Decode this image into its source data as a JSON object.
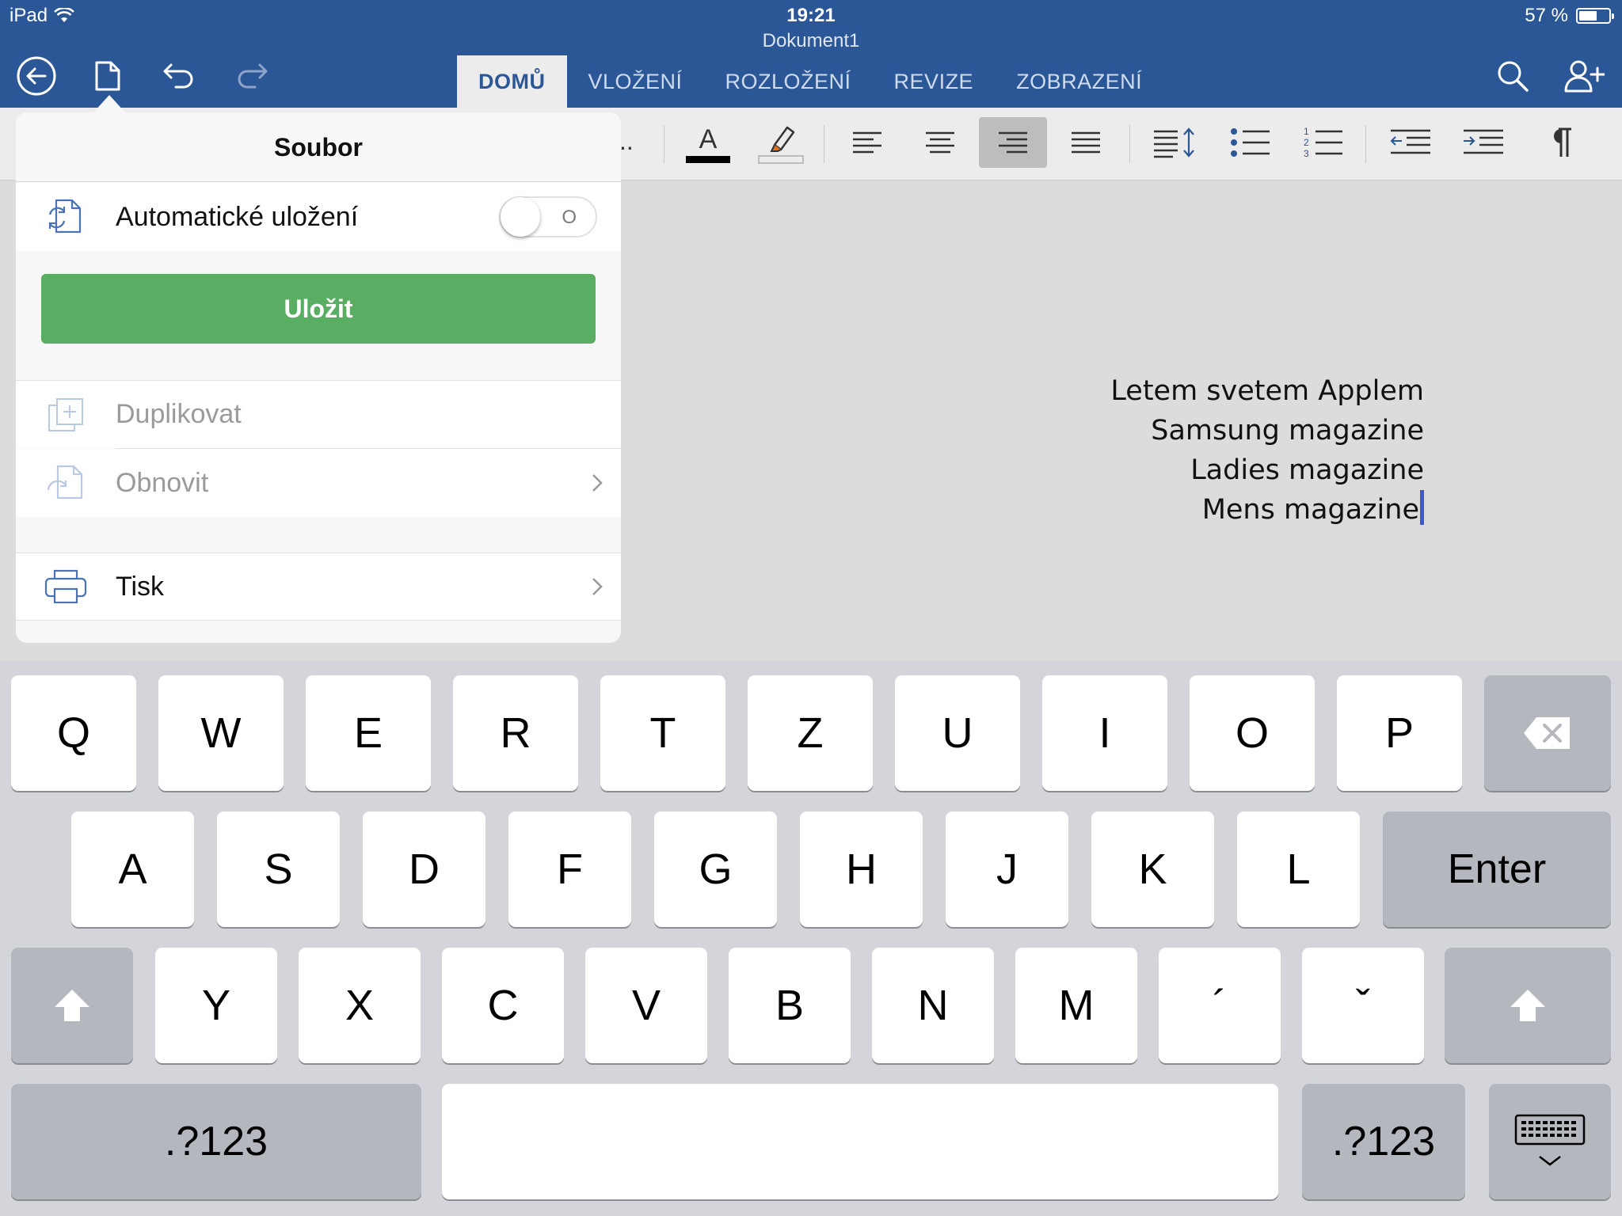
{
  "status_bar": {
    "device": "iPad",
    "time": "19:21",
    "battery": "57 %"
  },
  "document_title": "Dokument1",
  "toolbar_icons": [
    "back-icon",
    "file-icon",
    "undo-icon",
    "redo-icon",
    "search-icon",
    "share-person-icon"
  ],
  "tabs": [
    {
      "label": "DOMŮ",
      "active": true
    },
    {
      "label": "VLOŽENÍ"
    },
    {
      "label": "ROZLOŽENÍ"
    },
    {
      "label": "REVIZE"
    },
    {
      "label": "ZOBRAZENÍ"
    }
  ],
  "ribbon": {
    "font_color_letter": "A",
    "ellipsis": "..",
    "active_alignment": "align-right"
  },
  "document": {
    "lines": [
      "Letem svetem Applem",
      "Samsung magazine",
      "Ladies magazine",
      "Mens magazine"
    ]
  },
  "file_menu": {
    "title": "Soubor",
    "autosave_label": "Automatické uložení",
    "autosave_state": "O",
    "save_label": "Uložit",
    "duplicate_label": "Duplikovat",
    "restore_label": "Obnovit",
    "print_label": "Tisk"
  },
  "keyboard": {
    "row1": [
      "Q",
      "W",
      "E",
      "R",
      "T",
      "Z",
      "U",
      "I",
      "O",
      "P"
    ],
    "row2": [
      "A",
      "S",
      "D",
      "F",
      "G",
      "H",
      "J",
      "K",
      "L"
    ],
    "row3": [
      "Y",
      "X",
      "C",
      "V",
      "B",
      "N",
      "M",
      "´",
      "ˇ"
    ],
    "enter": "Enter",
    "numbers": ".?123",
    "numbers_right": ".?123"
  },
  "colors": {
    "topbar": "#2b5797",
    "save_button": "#5aae63",
    "caret": "#3d5bc9"
  }
}
